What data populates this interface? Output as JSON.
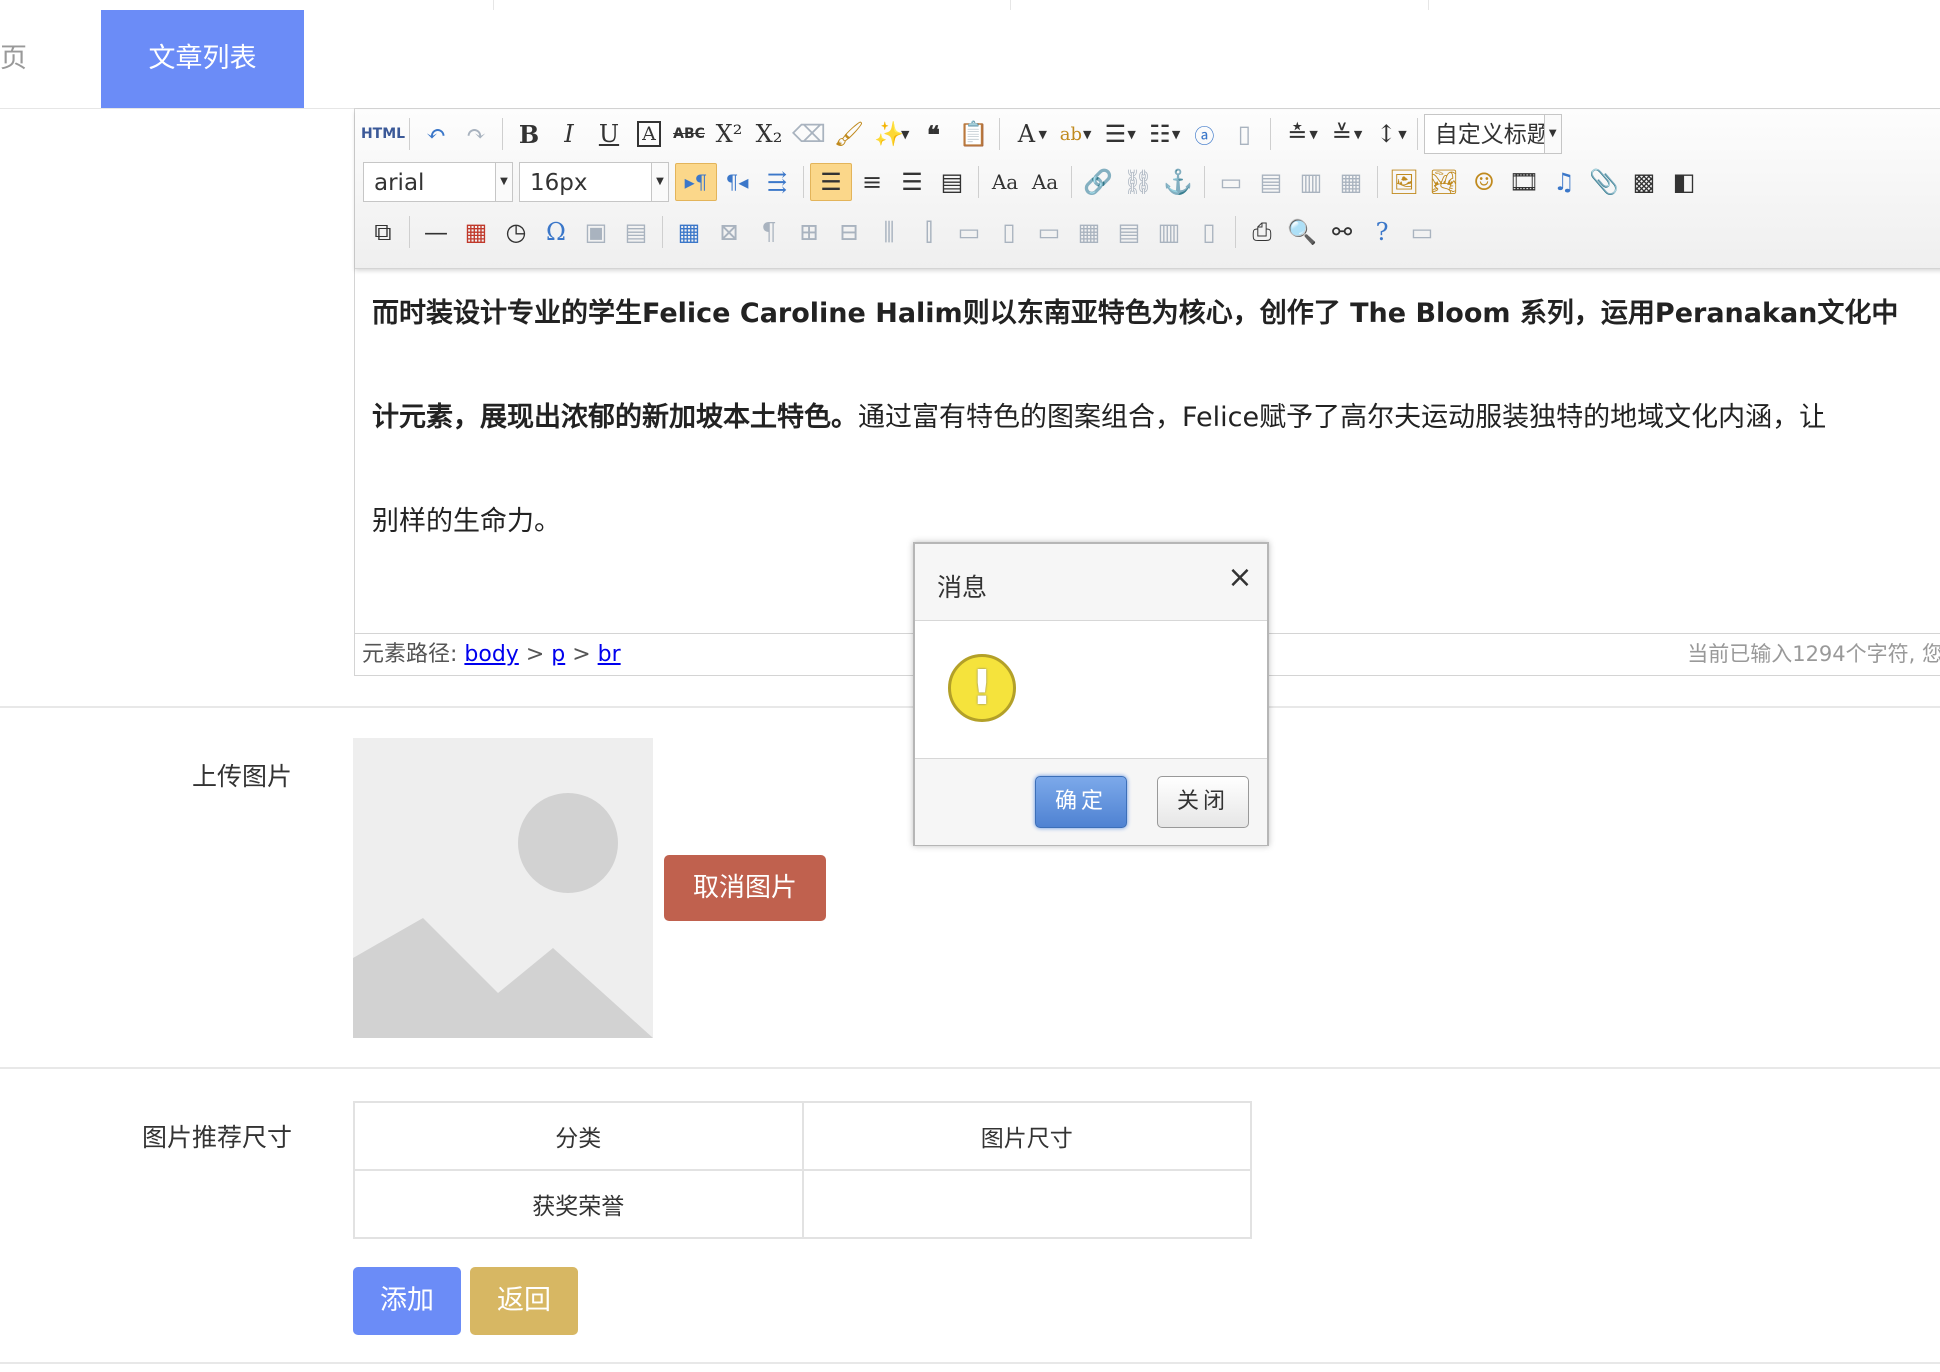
{
  "tabs": {
    "partial_label": "页",
    "active_label": "文章列表"
  },
  "editor": {
    "font_family": "arial",
    "font_size": "16px",
    "custom_heading": "自定义标题",
    "html_label": "HTML",
    "content": {
      "line1": "而时装设计专业的学生Felice Caroline Halim则以东南亚特色为核心，创作了 The Bloom 系列，运用Peranakan文化中",
      "line2_bold": "计元素，展现出浓郁的新加坡本土特色。",
      "line2_rest": "通过富有特色的图案组合，Felice赋予了高尔夫运动服装独特的地域文化内涵，让",
      "line3": "别样的生命力。"
    },
    "status": {
      "path_label": "元素路径: ",
      "path_body": "body",
      "path_p": "p",
      "path_br": "br",
      "path_sep": " > ",
      "counter": "当前已输入1294个字符, 您"
    }
  },
  "dialog": {
    "title": "消息",
    "close_glyph": "×",
    "icon_glyph": "!",
    "ok_label": "确定",
    "close_label": "关闭"
  },
  "form": {
    "upload_label": "上传图片",
    "cancel_image_label": "取消图片",
    "recommend_label": "图片推荐尺寸",
    "table": {
      "headers": [
        "分类",
        "图片尺寸"
      ],
      "rows": [
        [
          "获奖荣誉",
          ""
        ]
      ]
    },
    "add_label": "添加",
    "back_label": "返回"
  },
  "colors": {
    "primary": "#6b8cf7",
    "danger": "#c0614e",
    "warning": "#d7b763"
  }
}
